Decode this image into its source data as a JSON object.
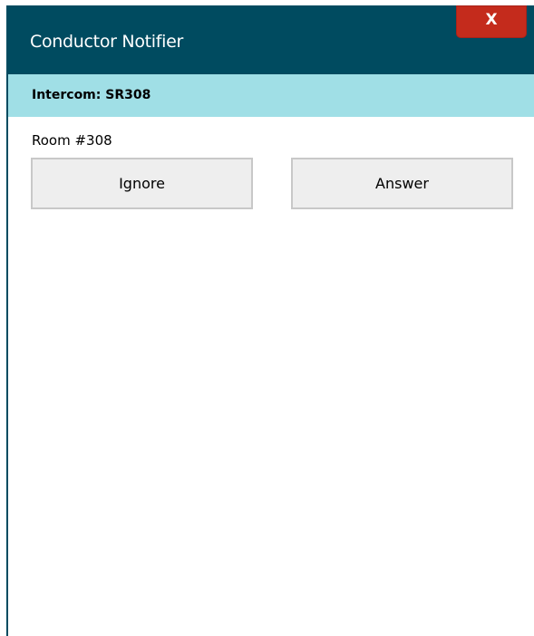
{
  "window": {
    "title": "Conductor Notifier",
    "close_label": "X"
  },
  "notification": {
    "header": "Intercom: SR308",
    "room": "Room #308"
  },
  "actions": {
    "ignore_label": "Ignore",
    "answer_label": "Answer"
  },
  "colors": {
    "titlebar": "#004b60",
    "header_band": "#a0dfe6",
    "close_button": "#c42b1c",
    "button_bg": "#eeeeee"
  }
}
